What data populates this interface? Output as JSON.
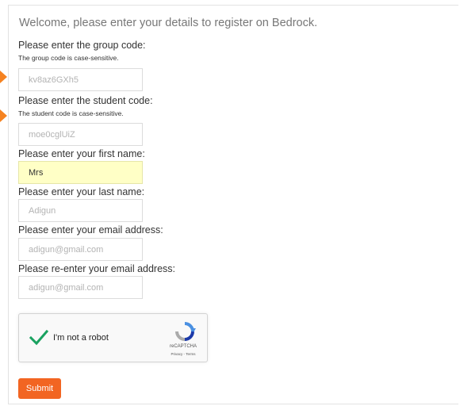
{
  "form": {
    "welcome": "Welcome, please enter your details to register on Bedrock.",
    "group_code": {
      "label": "Please enter the group code:",
      "hint": "The group code is case-sensitive.",
      "value": "kv8az6GXh5"
    },
    "student_code": {
      "label": "Please enter the student code:",
      "hint": "The student code is case-sensitive.",
      "value": "moe0cglUiZ"
    },
    "first_name": {
      "label": "Please enter your first name:",
      "value": "Mrs"
    },
    "last_name": {
      "label": "Please enter your last name:",
      "value": "Adigun"
    },
    "email": {
      "label": "Please enter your email address:",
      "value": "adigun@gmail.com"
    },
    "email_confirm": {
      "label": "Please re-enter your email address:",
      "value": "adigun@gmail.com"
    }
  },
  "captcha": {
    "label": "I'm not a robot",
    "brand": "reCAPTCHA",
    "terms": "Privacy - Terms",
    "checked": true,
    "check_color": "#1aa260"
  },
  "submit_label": "Submit",
  "colors": {
    "accent": "#f26522",
    "arrow": "#f58220",
    "filled_field": "#ffffc6"
  }
}
